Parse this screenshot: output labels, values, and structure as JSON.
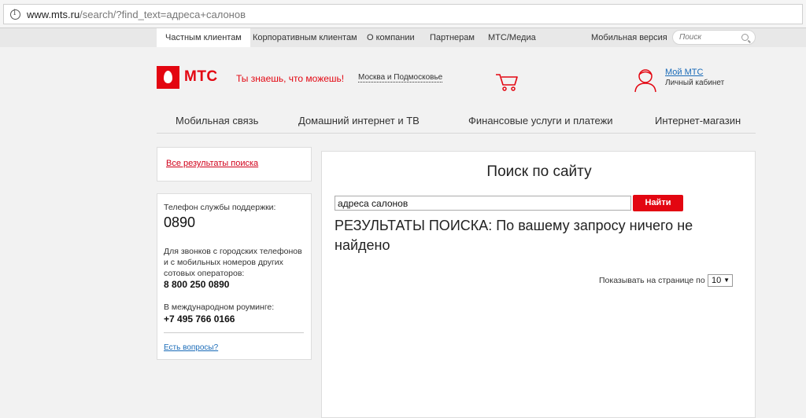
{
  "browser": {
    "url_host": "www.mts.ru",
    "url_path": "/search/?find_text=адреса+салонов"
  },
  "topnav": {
    "tabs": [
      "Частным клиентам",
      "Корпоративным клиентам",
      "О компании",
      "Партнерам",
      "МТС/Медиа",
      "Мобильная версия"
    ],
    "search_placeholder": "Поиск"
  },
  "header": {
    "logo": "МТС",
    "slogan": "Ты знаешь, что можешь!",
    "region": "Москва и Подмосковье",
    "my_mts": "Мой МТС",
    "cabinet": "Личный кабинет"
  },
  "mainnav": [
    "Мобильная связь",
    "Домашний интернет и ТВ",
    "Финансовые услуги и платежи",
    "Интернет-магазин"
  ],
  "sidebar": {
    "all_results": "Все результаты поиска",
    "support_label": "Телефон службы поддержки:",
    "support_number": "0890",
    "calls_label": "Для звонков с городских телефонов и с мобильных номеров других сотовых операторов:",
    "calls_number": "8 800 250 0890",
    "roaming_label": "В международном роуминге:",
    "roaming_number": "+7 495 766 0166",
    "questions": "Есть вопросы?"
  },
  "main": {
    "title": "Поиск по сайту",
    "query": "адреса салонов",
    "find_button": "Найти",
    "result_message": "РЕЗУЛЬТАТЫ ПОИСКА: По вашему запросу ничего не найдено",
    "per_page_label": "Показывать на странице по",
    "per_page_value": "10"
  },
  "colors": {
    "brand_red": "#e30611",
    "link_blue": "#1a6bb8"
  }
}
